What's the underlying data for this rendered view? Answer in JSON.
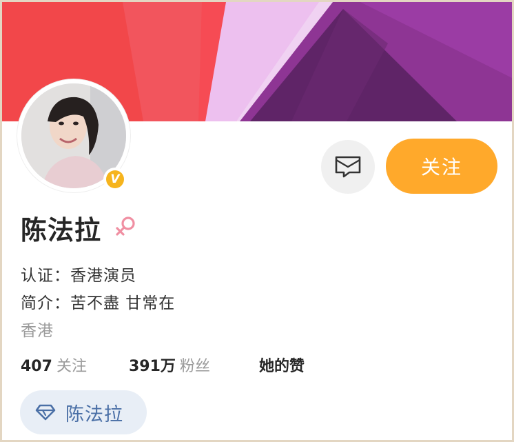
{
  "profile": {
    "name": "陈法拉",
    "gender_icon": "female-icon",
    "verified_badge": "V",
    "verification_line": "认证：香港演员",
    "bio_line": "简介：苦不盡 甘常在",
    "location": "香港"
  },
  "actions": {
    "message_icon": "message-icon",
    "follow_label": "关注"
  },
  "stats": {
    "following_count": "407",
    "following_label": "关注",
    "followers_count": "391万",
    "followers_label": "粉丝",
    "likes_label": "她的赞"
  },
  "group_tag": {
    "icon": "diamond-icon",
    "label": "陈法拉"
  },
  "colors": {
    "accent_orange": "#ffa92b",
    "banner_red": "#f2474a",
    "banner_purple": "#7a2a86",
    "tag_blue": "#4a6fa6"
  }
}
